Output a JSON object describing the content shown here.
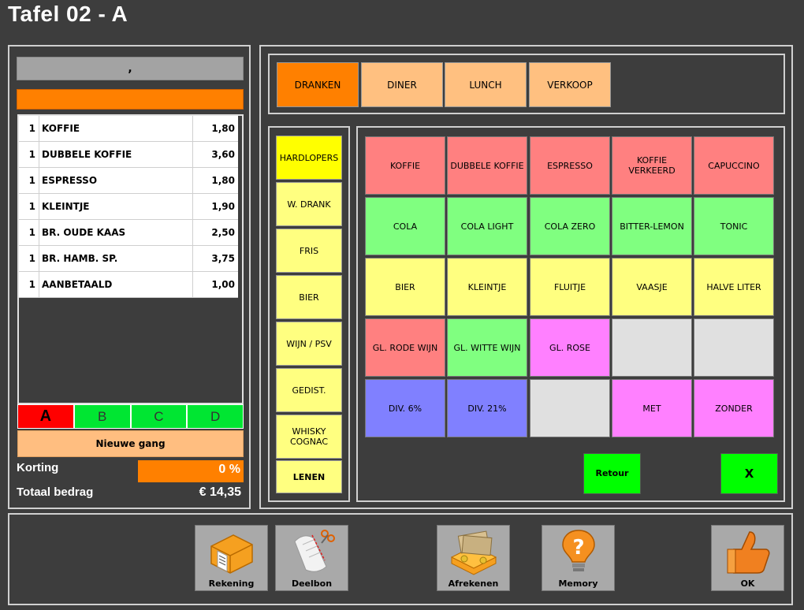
{
  "title": "Tafel 02 - A",
  "customer": {
    "name": ","
  },
  "order": {
    "rows": [
      {
        "qty": "1",
        "item": "KOFFIE",
        "price": "1,80"
      },
      {
        "qty": "1",
        "item": "DUBBELE KOFFIE",
        "price": "3,60"
      },
      {
        "qty": "1",
        "item": "ESPRESSO",
        "price": "1,80"
      },
      {
        "qty": "1",
        "item": "KLEINTJE",
        "price": "1,90"
      },
      {
        "qty": "1",
        "item": "BR. OUDE KAAS",
        "price": "2,50"
      },
      {
        "qty": "1",
        "item": "BR. HAMB. SP.",
        "price": "3,75"
      },
      {
        "qty": "1",
        "item": "AANBETAALD",
        "price": "1,00"
      }
    ]
  },
  "courses": {
    "a": "A",
    "b": "B",
    "c": "C",
    "d": "D",
    "active": "A"
  },
  "nieuwe_gang": "Nieuwe gang",
  "korting": {
    "label": "Korting",
    "value": "0 %"
  },
  "totaal": {
    "label": "Totaal bedrag",
    "value": "€ 14,35"
  },
  "categories": [
    {
      "label": "DRANKEN",
      "active": true
    },
    {
      "label": "DINER"
    },
    {
      "label": "LUNCH"
    },
    {
      "label": "VERKOOP"
    }
  ],
  "groups": [
    {
      "label": "HARDLOPERS",
      "active": true
    },
    {
      "label": "W. DRANK"
    },
    {
      "label": "FRIS"
    },
    {
      "label": "BIER"
    },
    {
      "label": "WIJN / PSV"
    },
    {
      "label": "GEDIST."
    },
    {
      "label": "WHISKY COGNAC"
    },
    {
      "label": "LENEN"
    }
  ],
  "items": [
    {
      "label": "KOFFIE",
      "color": "#ff8080"
    },
    {
      "label": "DUBBELE KOFFIE",
      "color": "#ff8080"
    },
    {
      "label": "ESPRESSO",
      "color": "#ff8080"
    },
    {
      "label": "KOFFIE VERKEERD",
      "color": "#ff8080"
    },
    {
      "label": "CAPUCCINO",
      "color": "#ff8080"
    },
    {
      "label": "COLA",
      "color": "#80ff80"
    },
    {
      "label": "COLA LIGHT",
      "color": "#80ff80"
    },
    {
      "label": "COLA ZERO",
      "color": "#80ff80"
    },
    {
      "label": "BITTER-LEMON",
      "color": "#80ff80"
    },
    {
      "label": "TONIC",
      "color": "#80ff80"
    },
    {
      "label": "BIER",
      "color": "#ffff80"
    },
    {
      "label": "KLEINTJE",
      "color": "#ffff80"
    },
    {
      "label": "FLUITJE",
      "color": "#ffff80"
    },
    {
      "label": "VAASJE",
      "color": "#ffff80"
    },
    {
      "label": "HALVE LITER",
      "color": "#ffff80"
    },
    {
      "label": "GL. RODE WIJN",
      "color": "#ff8080"
    },
    {
      "label": "GL. WITTE WIJN",
      "color": "#80ff80"
    },
    {
      "label": "GL. ROSE",
      "color": "#ff80ff"
    },
    {
      "label": "",
      "color": "#e0e0e0"
    },
    {
      "label": "",
      "color": "#e0e0e0"
    },
    {
      "label": "DIV. 6%",
      "color": "#8080ff"
    },
    {
      "label": "DIV. 21%",
      "color": "#8080ff"
    },
    {
      "label": "",
      "color": "#e0e0e0"
    },
    {
      "label": "MET",
      "color": "#ff80ff"
    },
    {
      "label": "ZONDER",
      "color": "#ff80ff"
    }
  ],
  "retour": "Retour",
  "close": "X",
  "actions": {
    "rekening": {
      "label": "Rekening",
      "icon": "printer-icon"
    },
    "deelbon": {
      "label": "Deelbon",
      "icon": "scissors-receipt-icon"
    },
    "afrekenen": {
      "label": "Afrekenen",
      "icon": "money-icon"
    },
    "memory": {
      "label": "Memory",
      "icon": "question-bulb-icon"
    },
    "ok": {
      "label": "OK",
      "icon": "thumbs-up-icon"
    }
  }
}
